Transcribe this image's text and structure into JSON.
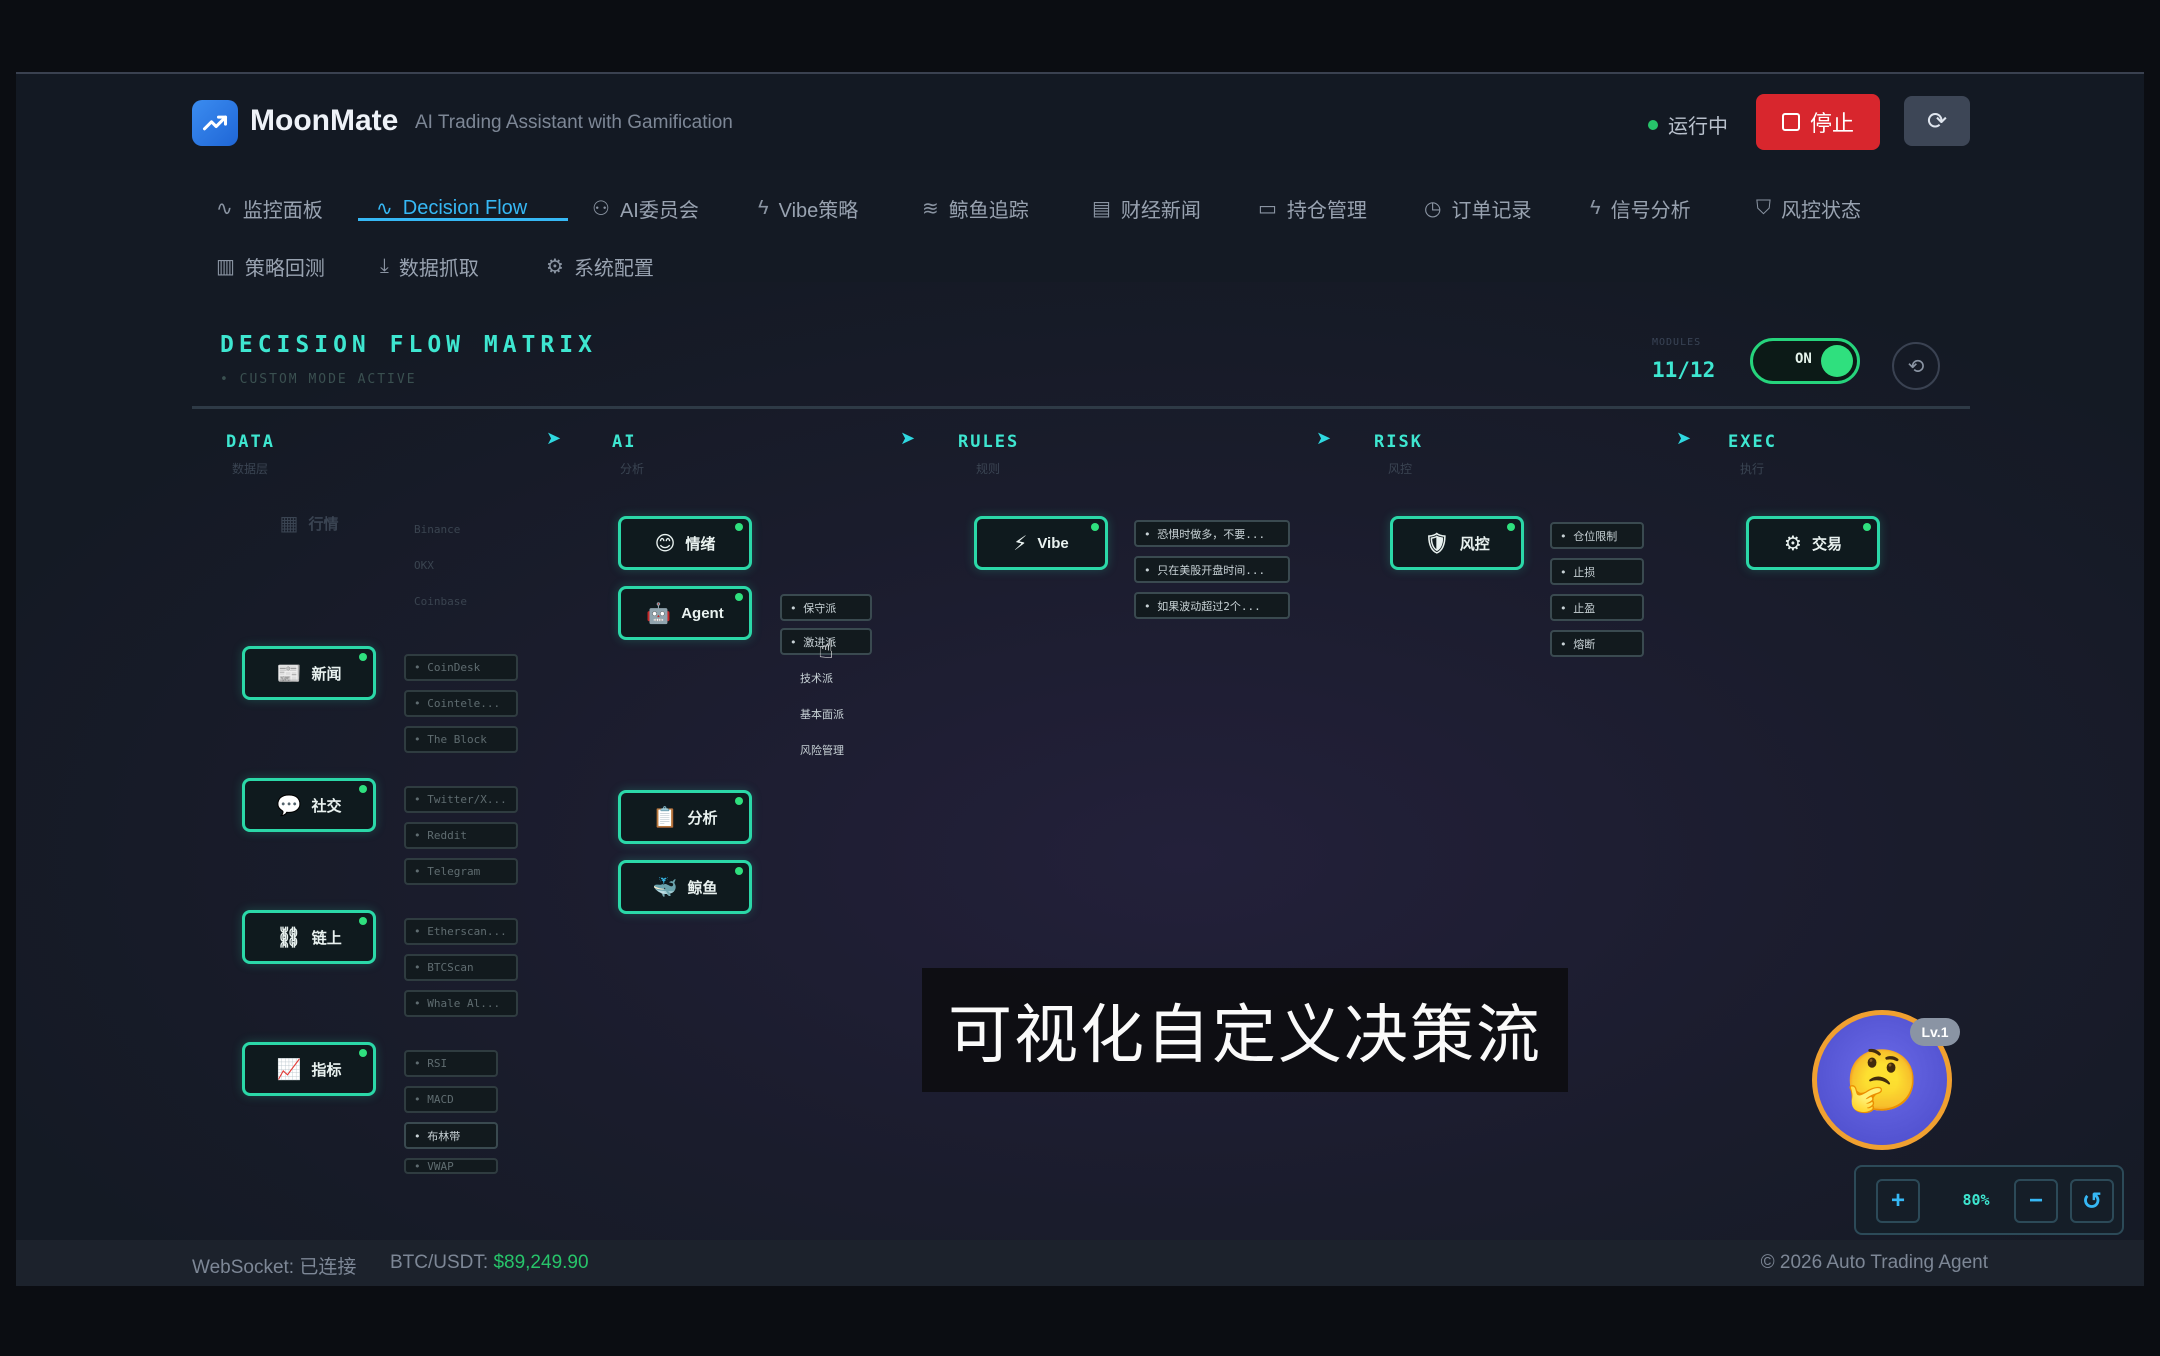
{
  "header": {
    "app_title": "MoonMate",
    "app_subtitle": "AI Trading Assistant with Gamification",
    "status_text": "运行中",
    "stop_label": "停止",
    "refresh_icon": "refresh-icon"
  },
  "tabs": [
    {
      "label": "监控面板",
      "icon": "activity-icon"
    },
    {
      "label": "Decision Flow",
      "icon": "activity-icon",
      "active": true
    },
    {
      "label": "AI委员会",
      "icon": "users-icon"
    },
    {
      "label": "Vibe策略",
      "icon": "bolt-icon"
    },
    {
      "label": "鲸鱼追踪",
      "icon": "waves-icon"
    },
    {
      "label": "财经新闻",
      "icon": "newspaper-icon"
    },
    {
      "label": "持仓管理",
      "icon": "wallet-icon"
    },
    {
      "label": "订单记录",
      "icon": "clock-icon"
    },
    {
      "label": "信号分析",
      "icon": "bolt-icon"
    },
    {
      "label": "风控状态",
      "icon": "shield-icon"
    },
    {
      "label": "策略回测",
      "icon": "bar-chart-icon"
    },
    {
      "label": "数据抓取",
      "icon": "download-icon"
    },
    {
      "label": "系统配置",
      "icon": "gear-icon"
    }
  ],
  "matrix": {
    "title": "DECISION FLOW MATRIX",
    "subtitle": "• CUSTOM MODE ACTIVE",
    "modules_label": "MODULES",
    "modules_count": "11/12",
    "toggle_label": "ON",
    "toggle_on": true
  },
  "columns": {
    "data": {
      "title": "DATA",
      "sub": "数据层"
    },
    "ai": {
      "title": "AI",
      "sub": "分析"
    },
    "rules": {
      "title": "RULES",
      "sub": "规则"
    },
    "risk": {
      "title": "RISK",
      "sub": "风控"
    },
    "exec": {
      "title": "EXEC",
      "sub": "执行"
    }
  },
  "nodes": {
    "market": {
      "label": "行情",
      "icon": "chart-icon"
    },
    "news": {
      "label": "新闻",
      "icon": "newspaper-icon"
    },
    "social": {
      "label": "社交",
      "icon": "chat-icon"
    },
    "onchain": {
      "label": "链上",
      "icon": "chain-icon"
    },
    "indicator": {
      "label": "指标",
      "icon": "trend-icon"
    },
    "sentiment": {
      "label": "情绪",
      "icon": "smile-icon"
    },
    "agent": {
      "label": "Agent",
      "icon": "robot-icon"
    },
    "analysis": {
      "label": "分析",
      "icon": "clipboard-icon"
    },
    "whale": {
      "label": "鲸鱼",
      "icon": "whale-icon"
    },
    "vibe": {
      "label": "Vibe",
      "icon": "bolt-icon"
    },
    "riskctl": {
      "label": "风控",
      "icon": "shield-icon"
    },
    "trade": {
      "label": "交易",
      "icon": "gear-icon"
    }
  },
  "chips": {
    "market": [
      "Binance",
      "OKX",
      "Coinbase"
    ],
    "news": [
      "CoinDesk",
      "Cointele...",
      "The Block"
    ],
    "social": [
      "Twitter/X...",
      "Reddit",
      "Telegram"
    ],
    "onchain": [
      "Etherscan...",
      "BTCScan",
      "Whale Al..."
    ],
    "indicator": [
      "RSI",
      "MACD",
      "布林带",
      "VWAP"
    ],
    "agent": [
      "保守派",
      "激进派",
      "技术派",
      "基本面派",
      "风险管理"
    ],
    "vibe": [
      "恐惧时做多，不要...",
      "只在美股开盘时间...",
      "如果波动超过2个..."
    ],
    "risk": [
      "仓位限制",
      "止损",
      "止盈",
      "熔断"
    ]
  },
  "subtitle_caption": "可视化自定义决策流",
  "mascot": {
    "level": "Lv.1",
    "icon": "thinking-face-icon"
  },
  "zoom": {
    "level": "80%"
  },
  "footer": {
    "websocket": "WebSocket: 已连接",
    "btc_label": "BTC/USDT: ",
    "btc_price": "$89,249.90",
    "copyright": "© 2026 Auto Trading Agent"
  },
  "colors": {
    "accent": "#36b8f5",
    "matrix_accent": "#3ee6d0",
    "node_border": "#2bd8a8",
    "stop_red": "#d8262d",
    "status_green": "#27c46a"
  }
}
